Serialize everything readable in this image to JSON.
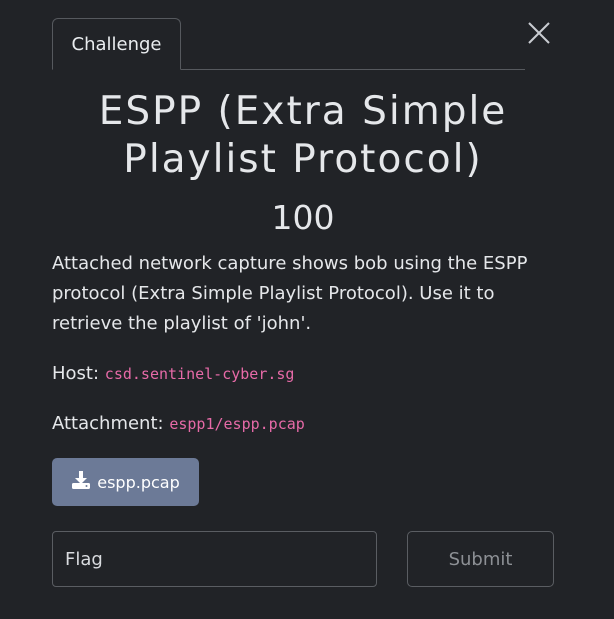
{
  "tabs": [
    {
      "label": "Challenge"
    }
  ],
  "challenge": {
    "title": "ESPP (Extra Simple Playlist Protocol)",
    "points": "100",
    "description": "Attached network capture shows bob using the ESPP protocol (Extra Simple Playlist Protocol). Use it to retrieve the playlist of 'john'.",
    "host_label": "Host:",
    "host_value": "csd.sentinel-cyber.sg",
    "attachment_label": "Attachment:",
    "attachment_value": "espp1/espp.pcap"
  },
  "download": {
    "label": "espp.pcap",
    "icon": "download-icon"
  },
  "flag": {
    "placeholder": "Flag",
    "value": ""
  },
  "submit": {
    "label": "Submit"
  },
  "colors": {
    "background": "#212327",
    "text": "#e5e7ea",
    "code": "#e66aa7",
    "download_button": "#6c7a97",
    "border": "#56595e"
  }
}
